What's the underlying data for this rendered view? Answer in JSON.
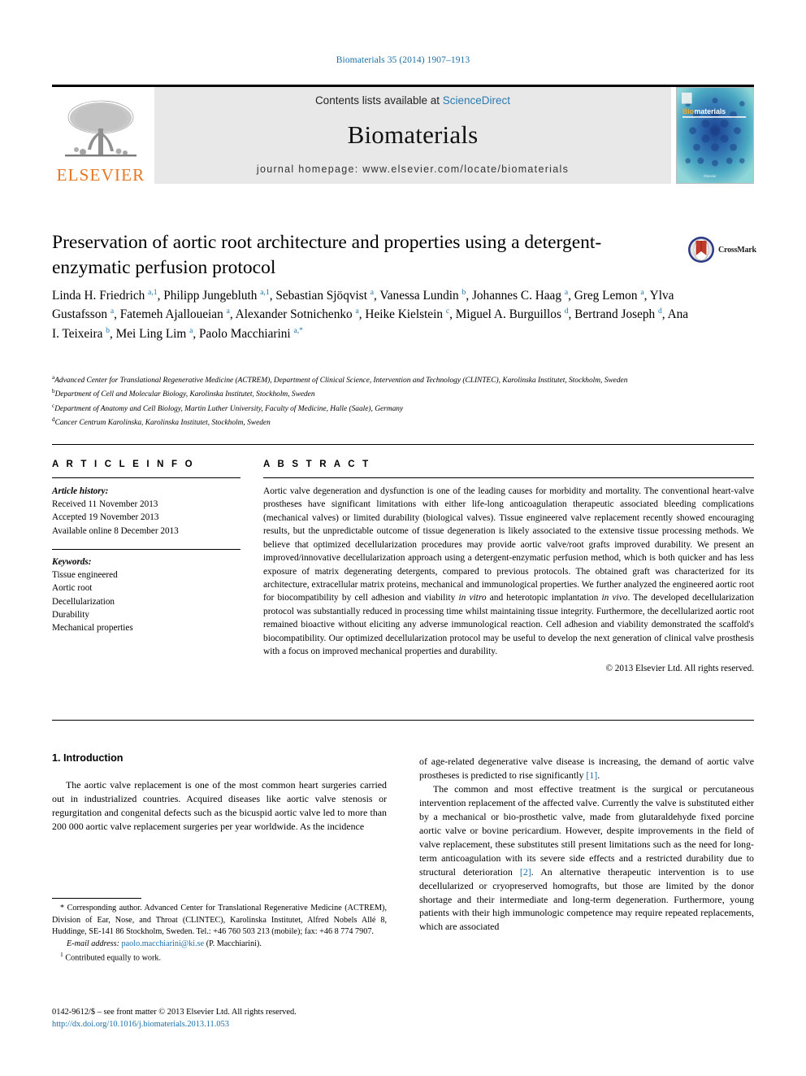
{
  "running_head": "Biomaterials 35 (2014) 1907–1913",
  "masthead": {
    "publisher_name": "ELSEVIER",
    "contents_prefix": "Contents lists available at ",
    "contents_link": "ScienceDirect",
    "journal_name": "Biomaterials",
    "homepage_line": "journal homepage: www.elsevier.com/locate/biomaterials",
    "cover_title_prefix": "Bio",
    "cover_title_suffix": "materials",
    "cover_footer": "Elsevier"
  },
  "crossmark": {
    "label": "CrossMark"
  },
  "article": {
    "title": "Preservation of aortic root architecture and properties using a detergent-enzymatic perfusion protocol",
    "authors_html": "Linda H. Friedrich <sup>a,1</sup>, Philipp Jungebluth <sup>a,1</sup>, Sebastian Sjöqvist <sup>a</sup>, Vanessa Lundin <sup>b</sup>, Johannes C. Haag <sup>a</sup>, Greg Lemon <sup>a</sup>, Ylva Gustafsson <sup>a</sup>, Fatemeh Ajalloueian <sup>a</sup>, Alexander Sotnichenko <sup>a</sup>, Heike Kielstein <sup>c</sup>, Miguel A. Burguillos <sup>d</sup>, Bertrand Joseph <sup>d</sup>, Ana I. Teixeira <sup>b</sup>, Mei Ling Lim <sup>a</sup>, Paolo Macchiarini <sup>a,*</sup>",
    "affiliations": [
      {
        "mark": "a",
        "text": "Advanced Center for Translational Regenerative Medicine (ACTREM), Department of Clinical Science, Intervention and Technology (CLINTEC), Karolinska Institutet, Stockholm, Sweden"
      },
      {
        "mark": "b",
        "text": "Department of Cell and Molecular Biology, Karolinska Institutet, Stockholm, Sweden"
      },
      {
        "mark": "c",
        "text": "Department of Anatomy and Cell Biology, Martin Luther University, Faculty of Medicine, Halle (Saale), Germany"
      },
      {
        "mark": "d",
        "text": "Cancer Centrum Karolinska, Karolinska Institutet, Stockholm, Sweden"
      }
    ]
  },
  "article_info": {
    "heading": "A R T I C L E  I N F O",
    "history_label": "Article history:",
    "history": [
      "Received 11 November 2013",
      "Accepted 19 November 2013",
      "Available online 8 December 2013"
    ],
    "keywords_label": "Keywords:",
    "keywords": [
      "Tissue engineered",
      "Aortic root",
      "Decellularization",
      "Durability",
      "Mechanical properties"
    ]
  },
  "abstract": {
    "heading": "A B S T R A C T",
    "text_html": "Aortic valve degeneration and dysfunction is one of the leading causes for morbidity and mortality. The conventional heart-valve prostheses have significant limitations with either life-long anticoagulation therapeutic associated bleeding complications (mechanical valves) or limited durability (biological valves). Tissue engineered valve replacement recently showed encouraging results, but the unpredictable outcome of tissue degeneration is likely associated to the extensive tissue processing methods. We believe that optimized decellularization procedures may provide aortic valve/root grafts improved durability. We present an improved/innovative decellularization approach using a detergent-enzymatic perfusion method, which is both quicker and has less exposure of matrix degenerating detergents, compared to previous protocols. The obtained graft was characterized for its architecture, extracellular matrix proteins, mechanical and immunological properties. We further analyzed the engineered aortic root for biocompatibility by cell adhesion and viability <i>in vitro</i> and heterotopic implantation <i>in vivo</i>. The developed decellularization protocol was substantially reduced in processing time whilst maintaining tissue integrity. Furthermore, the decellularized aortic root remained bioactive without eliciting any adverse immunological reaction. Cell adhesion and viability demonstrated the scaffold's biocompatibility. Our optimized decellularization protocol may be useful to develop the next generation of clinical valve prosthesis with a focus on improved mechanical properties and durability.",
    "copyright": "© 2013 Elsevier Ltd. All rights reserved."
  },
  "body": {
    "section_number_title": "1.  Introduction",
    "left_paragraphs_html": [
      "The aortic valve replacement is one of the most common heart surgeries carried out in industrialized countries. Acquired diseases like aortic valve stenosis or regurgitation and congenital defects such as the bicuspid aortic valve led to more than 200 000 aortic valve replacement surgeries per year worldwide. As the incidence"
    ],
    "right_paragraphs_html": [
      "of age-related degenerative valve disease is increasing, the demand of aortic valve prostheses is predicted to rise significantly <span class=\"ref\">[1]</span>.",
      "The common and most effective treatment is the surgical or percutaneous intervention replacement of the affected valve. Currently the valve is substituted either by a mechanical or bio-prosthetic valve, made from glutaraldehyde fixed porcine aortic valve or bovine pericardium. However, despite improvements in the field of valve replacement, these substitutes still present limitations such as the need for long-term anticoagulation with its severe side effects and a restricted durability due to structural deterioration <span class=\"ref\">[2]</span>. An alternative therapeutic intervention is to use decellularized or cryopreserved homografts, but those are limited by the donor shortage and their intermediate and long-term degeneration. Furthermore, young patients with their high immunologic competence may require repeated replacements, which are associated"
    ]
  },
  "footnotes": {
    "corresponding_html": "* Corresponding author. Advanced Center for Translational Regenerative Medicine (ACTREM), Division of Ear, Nose, and Throat (CLINTEC), Karolinska Institutet, Alfred Nobels Allé 8, Huddinge, SE-141 86 Stockholm, Sweden. Tel.: +46 760 503 213 (mobile); fax: +46 8 774 7907.",
    "email_label": "E-mail address:",
    "email": "paolo.macchiarini@ki.se",
    "email_owner": "(P. Macchiarini).",
    "contributed_mark": "1",
    "contributed_text": "Contributed equally to work."
  },
  "imprint": {
    "line1": "0142-9612/$ – see front matter © 2013 Elsevier Ltd. All rights reserved.",
    "doi": "http://dx.doi.org/10.1016/j.biomaterials.2013.11.053"
  },
  "colors": {
    "link_blue": "#1a6fa8",
    "elsevier_orange": "#E87722",
    "band_grey": "#e8e8e8",
    "cover_teal": "#5bc4cf"
  }
}
